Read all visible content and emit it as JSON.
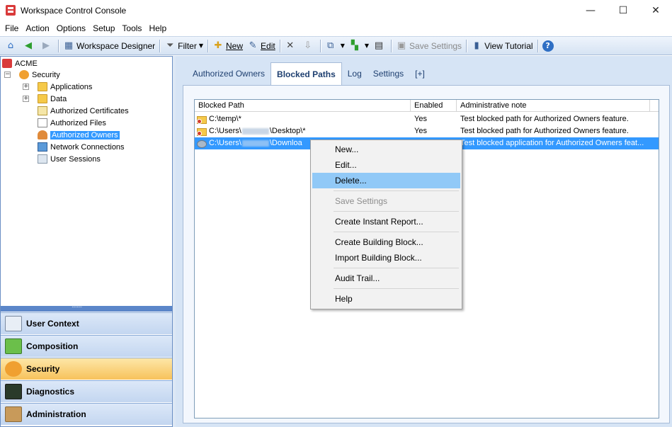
{
  "window": {
    "title": "Workspace Control Console",
    "minimize": "—",
    "maximize": "☐",
    "close": "✕"
  },
  "menubar": [
    "File",
    "Action",
    "Options",
    "Setup",
    "Tools",
    "Help"
  ],
  "toolbar": {
    "workspace_designer": "Workspace Designer",
    "filter": "Filter",
    "new": "New",
    "edit": "Edit",
    "save_settings": "Save Settings",
    "view_tutorial": "View Tutorial"
  },
  "tree": {
    "root": "ACME",
    "security": "Security",
    "items": [
      "Applications",
      "Data",
      "Authorized Certificates",
      "Authorized Files",
      "Authorized Owners",
      "Network Connections",
      "User Sessions"
    ]
  },
  "nav": [
    "User Context",
    "Composition",
    "Security",
    "Diagnostics",
    "Administration"
  ],
  "tabs": [
    "Authorized Owners",
    "Blocked Paths",
    "Log",
    "Settings",
    "[+]"
  ],
  "list": {
    "columns": [
      "Blocked Path",
      "Enabled",
      "Administrative note"
    ],
    "rows": [
      {
        "path_a": "C:\\temp\\*",
        "path_b": "",
        "enabled": "Yes",
        "note": "Test blocked path for Authorized Owners feature."
      },
      {
        "path_a": "C:\\Users\\",
        "path_b": "\\Desktop\\*",
        "enabled": "Yes",
        "note": "Test blocked path for Authorized Owners feature."
      },
      {
        "path_a": "C:\\Users\\",
        "path_b": "\\Downloa",
        "enabled": "",
        "note": "Test blocked application for Authorized Owners feat..."
      }
    ]
  },
  "context_menu": {
    "new": "New...",
    "edit": "Edit...",
    "delete": "Delete...",
    "save_settings": "Save Settings",
    "instant_report": "Create Instant Report...",
    "create_bb": "Create Building Block...",
    "import_bb": "Import Building Block...",
    "audit": "Audit Trail...",
    "help": "Help"
  }
}
